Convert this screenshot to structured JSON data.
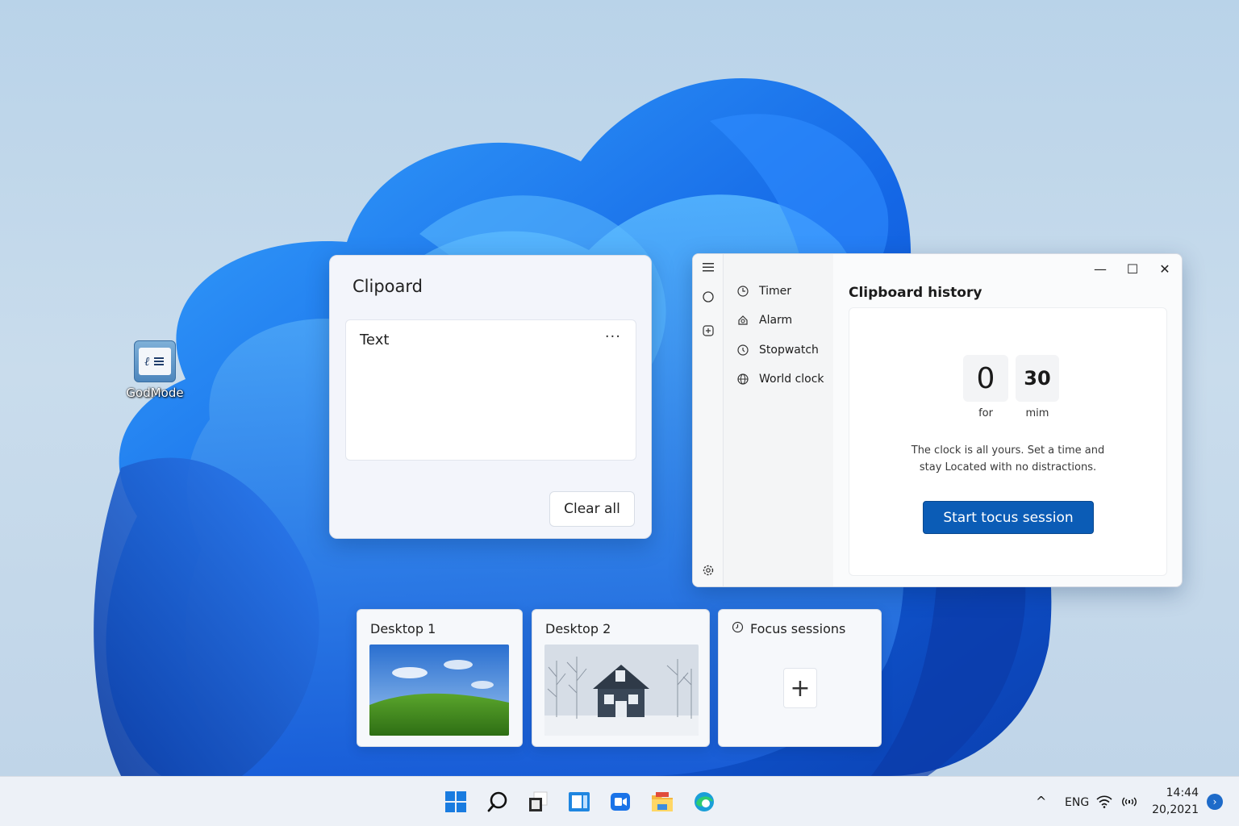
{
  "desktop": {
    "icon_label": "GodMode"
  },
  "clipboard_panel": {
    "title": "Clipoard",
    "item_text": "Text",
    "item_more": "···",
    "clear_label": "Clear all"
  },
  "clock_app": {
    "nav": [
      {
        "label": "Timer",
        "icon": "timer-icon"
      },
      {
        "label": "Alarm",
        "icon": "alarm-icon"
      },
      {
        "label": "Stopwatch",
        "icon": "stopwatch-icon"
      },
      {
        "label": "World clock",
        "icon": "globe-icon"
      }
    ],
    "heading": "Clipboard history",
    "hours_value": "0",
    "hours_unit": "for",
    "minutes_value": "30",
    "minutes_unit": "mim",
    "description_line1": "The clock is all yours. Set a time and",
    "description_line2": "stay Located with no distractions.",
    "start_button": "Start tocus session",
    "window_controls": {
      "minimize": "—",
      "maximize": "☐",
      "close": "✕"
    }
  },
  "task_view": {
    "desktops": [
      {
        "label": "Desktop 1"
      },
      {
        "label": "Desktop 2"
      }
    ],
    "focus_label": "Focus sessions",
    "add_symbol": "+"
  },
  "taskbar": {
    "icons": [
      "start-icon",
      "search-icon",
      "task-view-icon",
      "widgets-icon",
      "teams-icon",
      "file-explorer-icon",
      "edge-icon"
    ],
    "tray": {
      "chevron": "^",
      "language": "ENG",
      "time": "14:44",
      "date": "20,2021",
      "notification_symbol": "›"
    }
  },
  "colors": {
    "accent": "#0b5cb6",
    "wallpaper_blue": "#1565e0",
    "background": "#c4d9ec"
  }
}
